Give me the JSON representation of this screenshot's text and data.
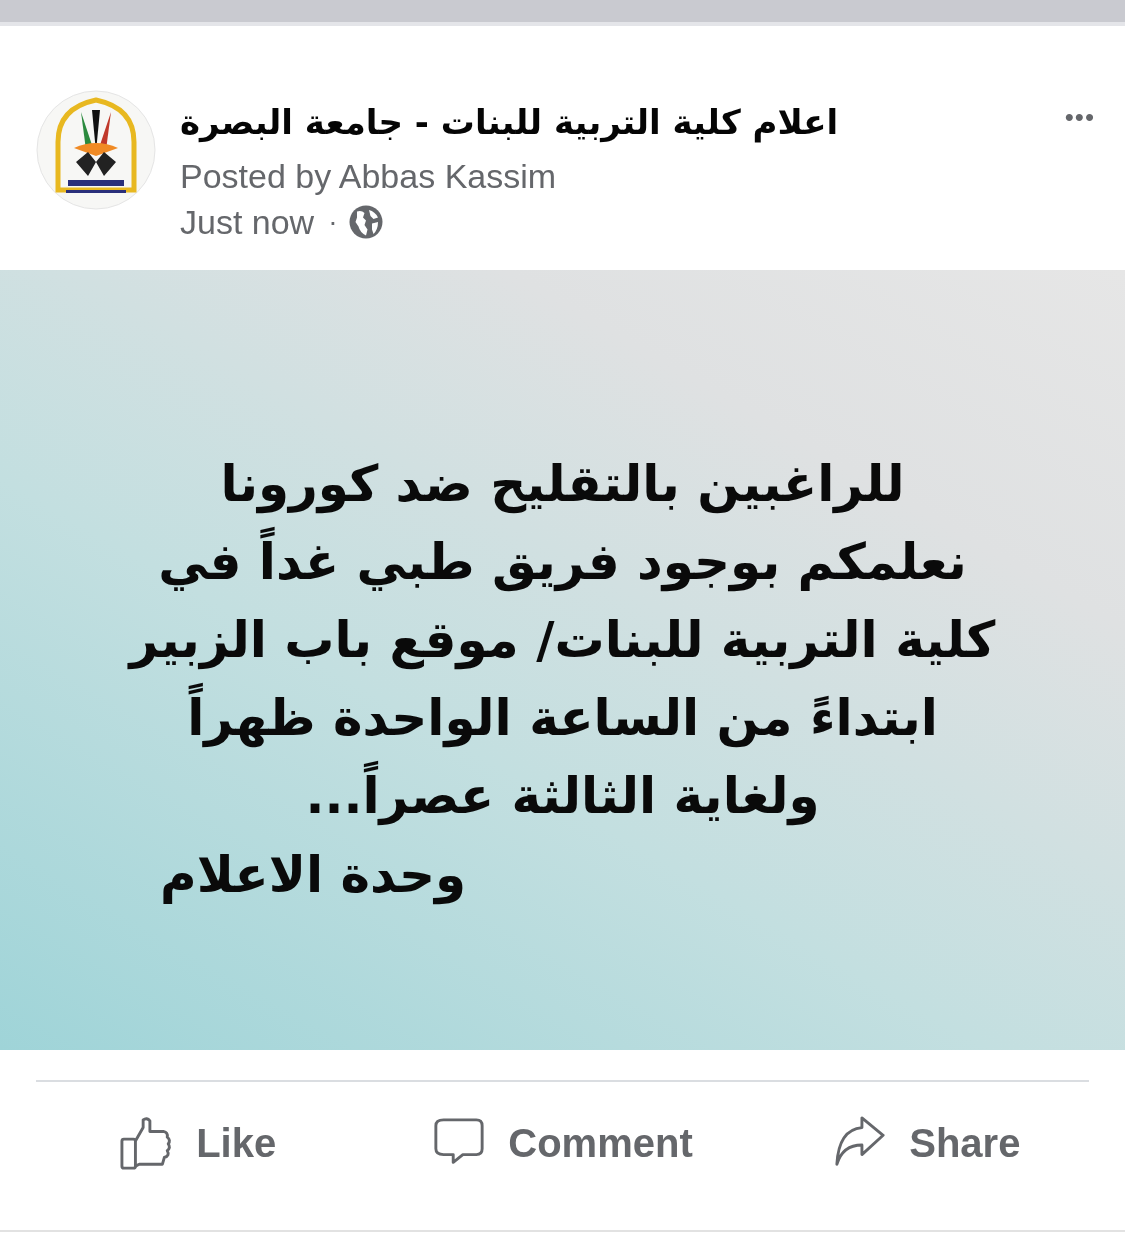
{
  "post": {
    "page_name": "اعلام كلية التربية للبنات - جامعة البصرة",
    "posted_by": "Posted by Abbas Kassim",
    "time": "Just now",
    "separator": "·",
    "more_menu": "•••",
    "body_lines": [
      "للراغبين بالتقليح ضد كورونا",
      "نعلمكم بوجود فريق طبي غداً في",
      "كلية التربية للبنات/ موقع باب الزبير",
      "ابتداءً من الساعة الواحدة ظهراً",
      "ولغاية الثالثة عصراً..."
    ],
    "signature": "وحدة الاعلام"
  },
  "action_bar": {
    "like_button": "Like",
    "comment_button": "Comment",
    "share_button": "Share"
  }
}
